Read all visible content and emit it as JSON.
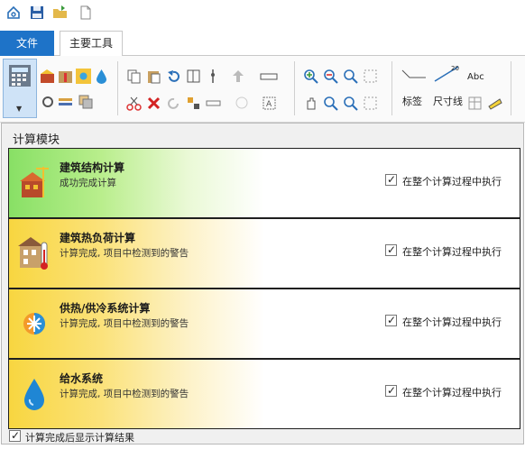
{
  "quick_access": {
    "items": [
      "home-icon",
      "save-icon",
      "open-folder-icon",
      "new-document-icon"
    ]
  },
  "tabs": {
    "file_label": "文件",
    "main_tools_label": "主要工具"
  },
  "ribbon": {
    "tag_label": "标签",
    "dimension_label": "尺寸线",
    "text_label": "Abc"
  },
  "panel": {
    "title": "计算模块",
    "modules": [
      {
        "name": "建筑结构计算",
        "status": "成功完成计算",
        "execute_label": "在整个计算过程中执行",
        "checked": true,
        "color": "#8fe26a"
      },
      {
        "name": "建筑热负荷计算",
        "status": "计算完成, 项目中检测到的警告",
        "execute_label": "在整个计算过程中执行",
        "checked": true,
        "color": "#f7d94a"
      },
      {
        "name": "供热/供冷系统计算",
        "status": "计算完成, 项目中检测到的警告",
        "execute_label": "在整个计算过程中执行",
        "checked": true,
        "color": "#f7d94a"
      },
      {
        "name": "给水系统",
        "status": "计算完成, 项目中检测到的警告",
        "execute_label": "在整个计算过程中执行",
        "checked": true,
        "color": "#f7d94a"
      }
    ],
    "show_results_label": "计算完成后显示计算结果",
    "show_results_checked": true
  }
}
